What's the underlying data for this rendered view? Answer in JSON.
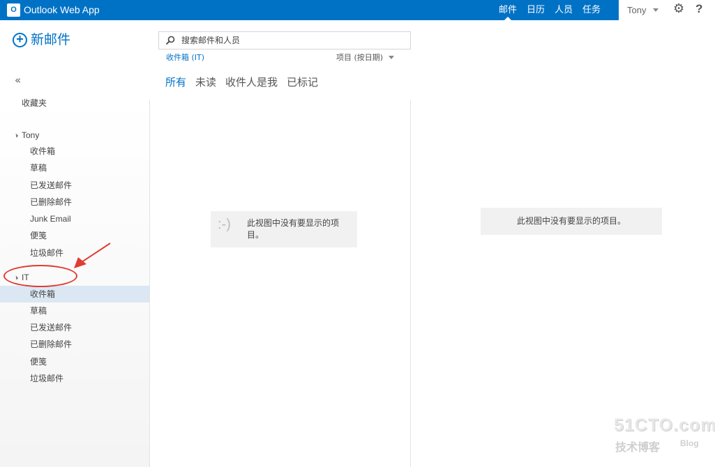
{
  "header": {
    "logo_text": "O",
    "app_title": "Outlook Web App",
    "nav": [
      {
        "label": "邮件"
      },
      {
        "label": "日历"
      },
      {
        "label": "人员"
      },
      {
        "label": "任务"
      }
    ],
    "user_name": "Tony",
    "settings_icon": "gear-icon",
    "help_label": "?"
  },
  "sidebar": {
    "new_mail_label": "新邮件",
    "collapse_label": "«",
    "favorites_label": "收藏夹",
    "accounts": [
      {
        "name": "Tony",
        "folders": [
          "收件箱",
          "草稿",
          "已发送邮件",
          "已删除邮件",
          "Junk Email",
          "便笺",
          "垃圾邮件"
        ]
      },
      {
        "name": "IT",
        "folders": [
          "收件箱",
          "草稿",
          "已发送邮件",
          "已删除邮件",
          "便笺",
          "垃圾邮件"
        ]
      }
    ],
    "selected_folder": "IT/收件箱"
  },
  "list": {
    "search_placeholder": "搜索邮件和人员",
    "folder_crumb": "收件箱 (IT)",
    "sort_label": "项目 (按日期)",
    "filters": [
      "所有",
      "未读",
      "收件人是我",
      "已标记"
    ],
    "active_filter": "所有",
    "empty_icon": ":-)",
    "empty_message": "此视图中没有要显示的项目。"
  },
  "reading": {
    "empty_message": "此视图中没有要显示的项目。"
  },
  "watermark": {
    "main": "51CTO.com",
    "sub": "技术博客",
    "blog": "Blog"
  },
  "colors": {
    "accent": "#0072c6",
    "annotation": "#e03c31",
    "selected_bg": "#dbe7f3"
  }
}
